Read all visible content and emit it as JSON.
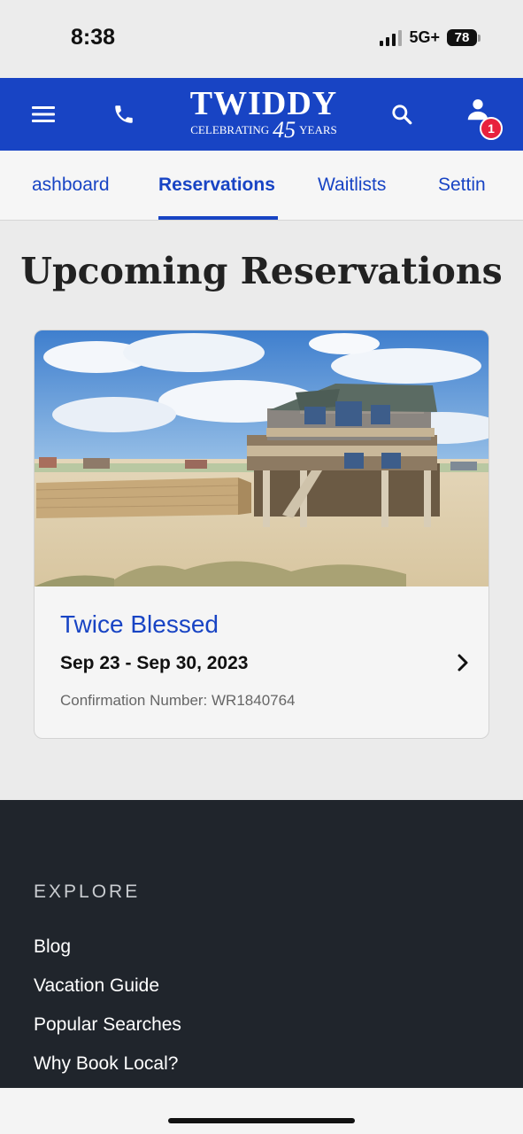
{
  "status_bar": {
    "time": "8:38",
    "network": "5G+",
    "battery": "78"
  },
  "header": {
    "logo_word": "TWIDDY",
    "logo_celebrating": "CELEBRATING",
    "logo_number": "45",
    "logo_years": "YEARS",
    "notification_count": "1",
    "brand_color": "#1844c4"
  },
  "tabs": [
    {
      "label": "Dashboard",
      "visible_label": "ashboard",
      "active": false
    },
    {
      "label": "Reservations",
      "visible_label": "Reservations",
      "active": true
    },
    {
      "label": "Waitlists",
      "visible_label": "Waitlists",
      "active": false
    },
    {
      "label": "Settings",
      "visible_label": "Settin",
      "active": false
    }
  ],
  "page_title": "Upcoming Reservations",
  "reservation": {
    "property_name": "Twice Blessed",
    "dates": "Sep 23 - Sep 30, 2023",
    "confirmation": "Confirmation Number: WR1840764"
  },
  "footer": {
    "heading": "EXPLORE",
    "links": [
      "Blog",
      "Vacation Guide",
      "Popular Searches",
      "Why Book Local?"
    ]
  }
}
